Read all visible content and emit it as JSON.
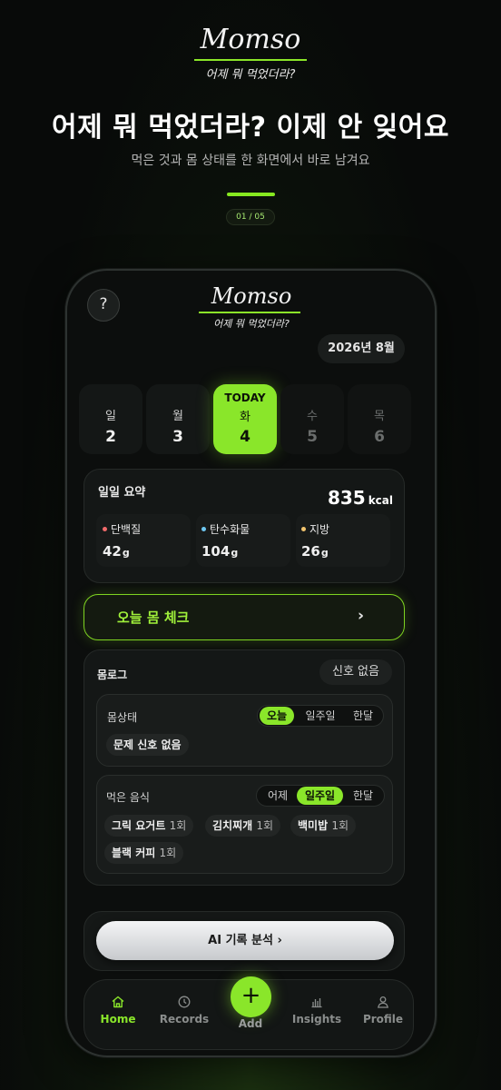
{
  "promo": {
    "logo": "Momso",
    "tagline": "어제 뭐 먹었더라?",
    "headline": "어제 뭐 먹었더라? 이제 안 잊어요",
    "subline": "먹은 것과 몸 상태를 한 화면에서 바로 남겨요",
    "page_indicator": "01 / 05",
    "accent_color": "#8AE62A"
  },
  "app": {
    "help_label": "?",
    "logo": "Momso",
    "tagline": "어제 뭐 먹었더라?",
    "month": "2026년 8월",
    "days": [
      {
        "dow": "일",
        "num": "2",
        "state": "past"
      },
      {
        "dow": "월",
        "num": "3",
        "state": "past"
      },
      {
        "dow": "화",
        "num": "4",
        "state": "today",
        "badge": "TODAY"
      },
      {
        "dow": "수",
        "num": "5",
        "state": "future"
      },
      {
        "dow": "목",
        "num": "6",
        "state": "future"
      }
    ],
    "summary": {
      "title": "일일 요약",
      "kcal": "835",
      "kcal_unit": "kcal",
      "macros": [
        {
          "name": "단백질",
          "value": "42",
          "unit": "g",
          "color": "#F26B6B"
        },
        {
          "name": "탄수화물",
          "value": "104",
          "unit": "g",
          "color": "#6EC8F2"
        },
        {
          "name": "지방",
          "value": "26",
          "unit": "g",
          "color": "#F2C46E"
        }
      ]
    },
    "body_check": {
      "label": "오늘 몸 체크",
      "chevron": "›"
    },
    "body_log": {
      "title": "몸로그",
      "signal": "신호 없음",
      "condition": {
        "title": "몸상태",
        "tabs": [
          "오늘",
          "일주일",
          "한달"
        ],
        "active_tab": "오늘",
        "chips": [
          "문제 신호 없음"
        ]
      },
      "foods": {
        "title": "먹은 음식",
        "tabs": [
          "어제",
          "일주일",
          "한달"
        ],
        "active_tab": "일주일",
        "chips": [
          {
            "name": "그릭 요거트",
            "count": "1회"
          },
          {
            "name": "김치찌개",
            "count": "1회"
          },
          {
            "name": "백미밥",
            "count": "1회"
          },
          {
            "name": "블랙 커피",
            "count": "1회"
          }
        ]
      }
    },
    "ai_button": "AI 기록 분석 ›",
    "nav": {
      "items": [
        {
          "label": "Home",
          "icon": "home-icon",
          "active": true
        },
        {
          "label": "Records",
          "icon": "clock-icon",
          "active": false
        },
        {
          "label": "Add",
          "icon": "plus-icon",
          "active": false
        },
        {
          "label": "Insights",
          "icon": "bar-chart-icon",
          "active": false
        },
        {
          "label": "Profile",
          "icon": "person-icon",
          "active": false
        }
      ],
      "add_symbol": "+"
    }
  }
}
